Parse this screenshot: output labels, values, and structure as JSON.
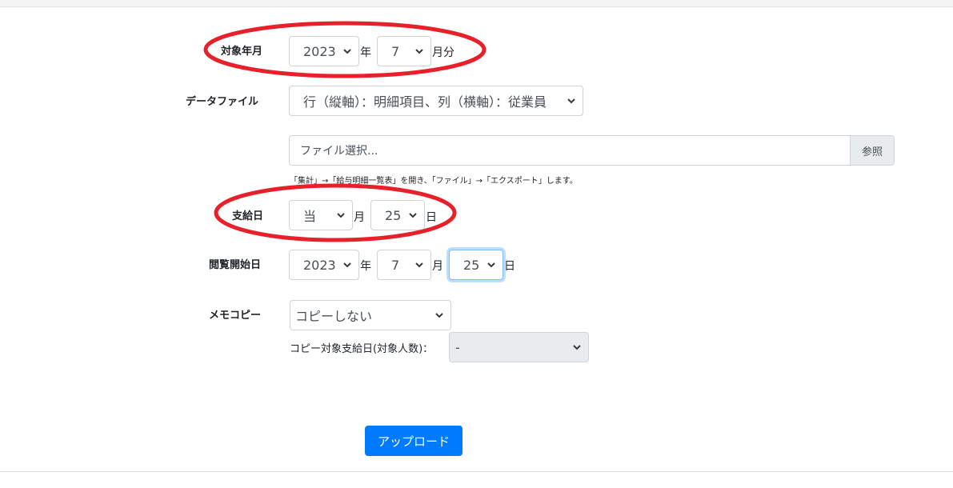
{
  "target_month": {
    "label": "対象年月",
    "year": "2023",
    "year_unit": "年",
    "month": "7",
    "month_unit": "月分"
  },
  "data_file": {
    "label": "データファイル",
    "layout_option": "行（縦軸）：明細項目、列（横軸）：従業員",
    "file_placeholder": "ファイル選択...",
    "browse_label": "参照",
    "note": "「集計」→「給与明細一覧表」を開き、「ファイル」→「エクスポート」します。"
  },
  "pay_day": {
    "label": "支給日",
    "month": "当",
    "month_unit": "月",
    "day": "25",
    "day_unit": "日"
  },
  "view_start": {
    "label": "閲覧開始日",
    "year": "2023",
    "year_unit": "年",
    "month": "7",
    "month_unit": "月",
    "day": "25",
    "day_unit": "日"
  },
  "memo_copy": {
    "label": "メモコピー",
    "option": "コピーしない",
    "target_label": "コピー対象支給日(対象人数)：",
    "target_value": "-"
  },
  "upload": {
    "label": "アップロード"
  },
  "colors": {
    "accent": "#007bff",
    "annotation": "#e8202a",
    "border": "#ced4da",
    "disabled_bg": "#e9ecef"
  }
}
